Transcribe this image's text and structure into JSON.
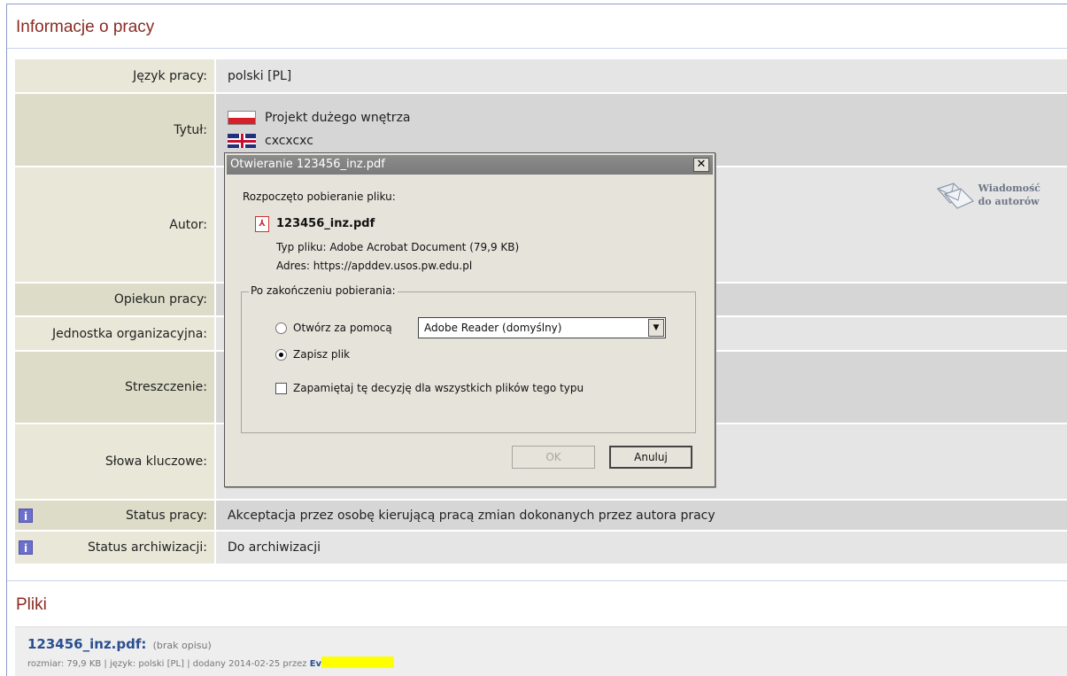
{
  "section_info": {
    "title": "Informacje o pracy"
  },
  "rows": {
    "jezyk": {
      "label": "Język pracy:",
      "value": "polski [PL]"
    },
    "tytul": {
      "label": "Tytuł:",
      "title_pl": "Projekt dużego wnętrza",
      "title_en": "cxcxcxc"
    },
    "autor": {
      "label": "Autor:"
    },
    "opiekun": {
      "label": "Opiekun pracy:"
    },
    "jednostka": {
      "label": "Jednostka organizacyjna:"
    },
    "streszczenie": {
      "label": "Streszczenie:"
    },
    "slowa": {
      "label": "Słowa kluczowe:"
    },
    "status_pracy": {
      "label": "Status pracy:",
      "value": "Akceptacja przez osobę kierującą pracą zmian dokonanych przez autora pracy"
    },
    "status_arch": {
      "label": "Status archiwizacji:",
      "value": "Do archiwizacji"
    }
  },
  "message_authors": {
    "line1": "Wiadomość",
    "line2": "do autorów"
  },
  "section_files": {
    "title": "Pliki"
  },
  "file": {
    "name": "123456_inz.pdf",
    "colon": ":",
    "desc": "(brak opisu)",
    "meta": "rozmiar: 79,9 KB | język: polski [PL] | dodany 2014-02-25 przez",
    "uploader": "Ev"
  },
  "dialog": {
    "title": "Otwieranie 123456_inz.pdf",
    "close": "✕",
    "intro": "Rozpoczęto pobieranie pliku:",
    "filename": "123456_inz.pdf",
    "type_label": "Typ pliku:",
    "type_value": "Adobe Acrobat Document (79,9 KB)",
    "address_label": "Adres:",
    "address_value": "https://apddev.usos.pw.edu.pl",
    "after_download": "Po zakończeniu pobierania:",
    "open_with": "Otwórz za pomocą",
    "open_with_app": "Adobe Reader  (domyślny)",
    "save_file": "Zapisz plik",
    "remember": "Zapamiętaj tę decyzję dla wszystkich plików tego typu",
    "ok": "OK",
    "cancel": "Anuluj"
  },
  "colors": {
    "section_title": "#8a2a22",
    "link": "#2a4f8f",
    "redaction": "#ffff00"
  }
}
